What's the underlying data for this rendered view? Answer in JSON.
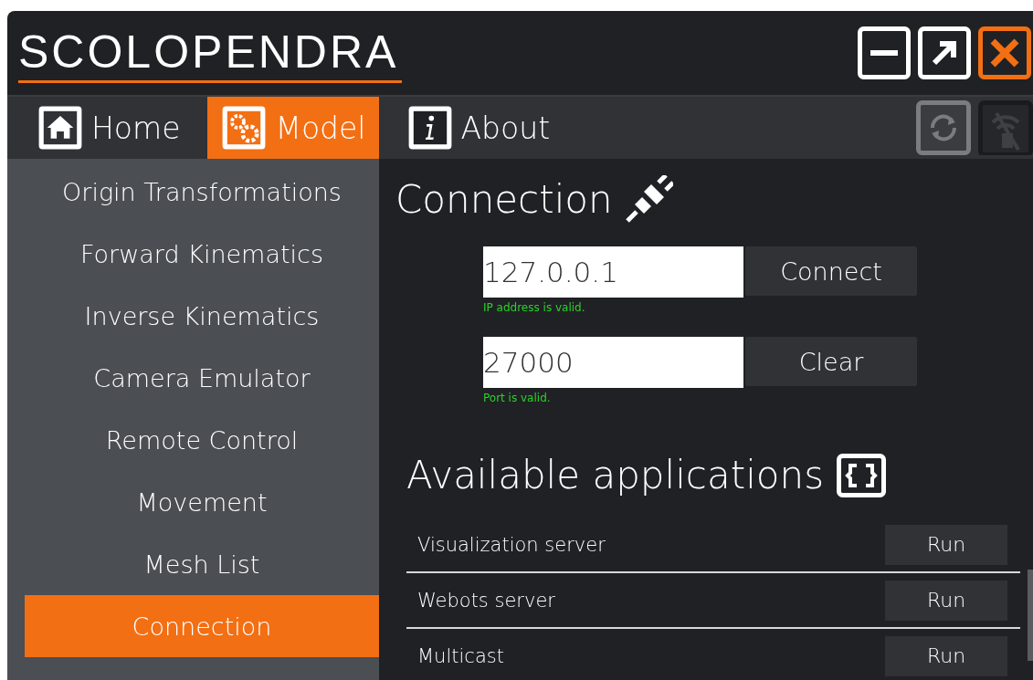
{
  "window": {
    "title": "SCOLOPENDRA"
  },
  "tabs": [
    {
      "label": "Home",
      "kind": "home",
      "selected": false
    },
    {
      "label": "Model",
      "kind": "gears",
      "selected": true
    },
    {
      "label": "About",
      "kind": "info",
      "selected": false
    }
  ],
  "sidebar": {
    "items": [
      {
        "label": "Origin Transformations",
        "selected": false
      },
      {
        "label": "Forward Kinematics",
        "selected": false
      },
      {
        "label": "Inverse Kinematics",
        "selected": false
      },
      {
        "label": "Camera Emulator",
        "selected": false
      },
      {
        "label": "Remote Control",
        "selected": false
      },
      {
        "label": "Movement",
        "selected": false
      },
      {
        "label": "Mesh List",
        "selected": false
      },
      {
        "label": "Connection",
        "selected": true
      }
    ]
  },
  "connection": {
    "title": "Connection",
    "fields": [
      {
        "value": "127.0.0.1",
        "button": "Connect",
        "hint": "IP address is valid."
      },
      {
        "value": "27000",
        "button": "Clear",
        "hint": "Port is valid."
      }
    ]
  },
  "applications": {
    "title": "Available applications",
    "rows": [
      {
        "name": "Visualization server",
        "button": "Run"
      },
      {
        "name": "Webots server",
        "button": "Run"
      },
      {
        "name": "Multicast",
        "button": "Run"
      }
    ]
  }
}
